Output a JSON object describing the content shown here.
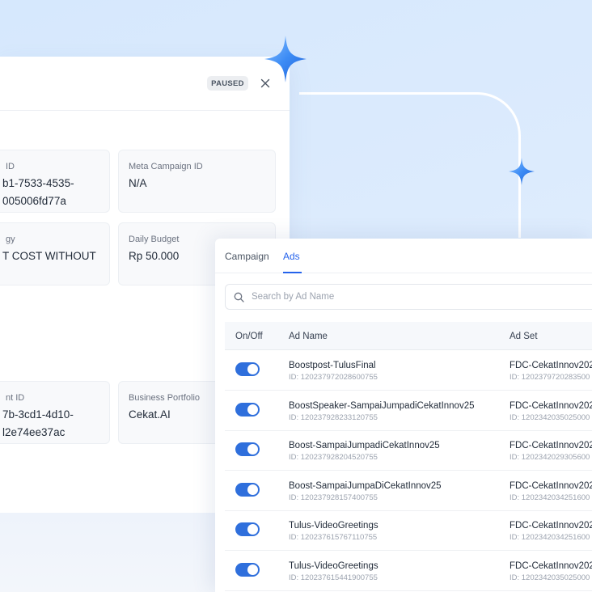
{
  "detail": {
    "status": "PAUSED",
    "cards": [
      {
        "label": "ID",
        "value": "b1-7533-4535-\n005006fd77a"
      },
      {
        "label": "Meta Campaign ID",
        "value": "N/A"
      },
      {
        "label": "gy",
        "value": "T COST WITHOUT"
      },
      {
        "label": "Daily Budget",
        "value": "Rp 50.000"
      },
      {
        "label": "nt ID",
        "value": "7b-3cd1-4d10-\nl2e74ee37ac"
      },
      {
        "label": "Business Portfolio",
        "value": "Cekat.AI"
      }
    ]
  },
  "ads_panel": {
    "tabs": [
      {
        "label": "Campaign",
        "active": false
      },
      {
        "label": "Ads",
        "active": true
      }
    ],
    "search": {
      "placeholder": "Search by Ad Name",
      "value": ""
    },
    "columns": [
      "On/Off",
      "Ad Name",
      "Ad Set"
    ],
    "rows": [
      {
        "on": true,
        "ad_name": "Boostpost-TulusFinal",
        "ad_id": "ID: 120237972028600755",
        "adset_name": "FDC-CekatInnov202",
        "adset_id": "ID: 1202379720283500"
      },
      {
        "on": true,
        "ad_name": "BoostSpeaker-SampaiJumpadiCekatInnov25",
        "ad_id": "ID: 120237928233120755",
        "adset_name": "FDC-CekatInnov202",
        "adset_id": "ID: 1202342035025000"
      },
      {
        "on": true,
        "ad_name": "Boost-SampaiJumpadiCekatInnov25",
        "ad_id": "ID: 120237928204520755",
        "adset_name": "FDC-CekatInnov202",
        "adset_id": "ID: 1202342029305600"
      },
      {
        "on": true,
        "ad_name": "Boost-SampaiJumpaDiCekatInnov25",
        "ad_id": "ID: 120237928157400755",
        "adset_name": "FDC-CekatInnov202",
        "adset_id": "ID: 1202342034251600"
      },
      {
        "on": true,
        "ad_name": "Tulus-VideoGreetings",
        "ad_id": "ID: 120237615767110755",
        "adset_name": "FDC-CekatInnov202",
        "adset_id": "ID: 1202342034251600"
      },
      {
        "on": true,
        "ad_name": "Tulus-VideoGreetings",
        "ad_id": "ID: 120237615441900755",
        "adset_name": "FDC-CekatInnov202",
        "adset_id": "ID: 1202342035025000"
      }
    ]
  },
  "icons": {
    "close": "close-icon",
    "search": "search-icon",
    "sparkle": "sparkle-icon"
  },
  "colors": {
    "accent": "#2563eb",
    "toggle_on": "#2f6fdc",
    "background": "#d6e8fd"
  }
}
